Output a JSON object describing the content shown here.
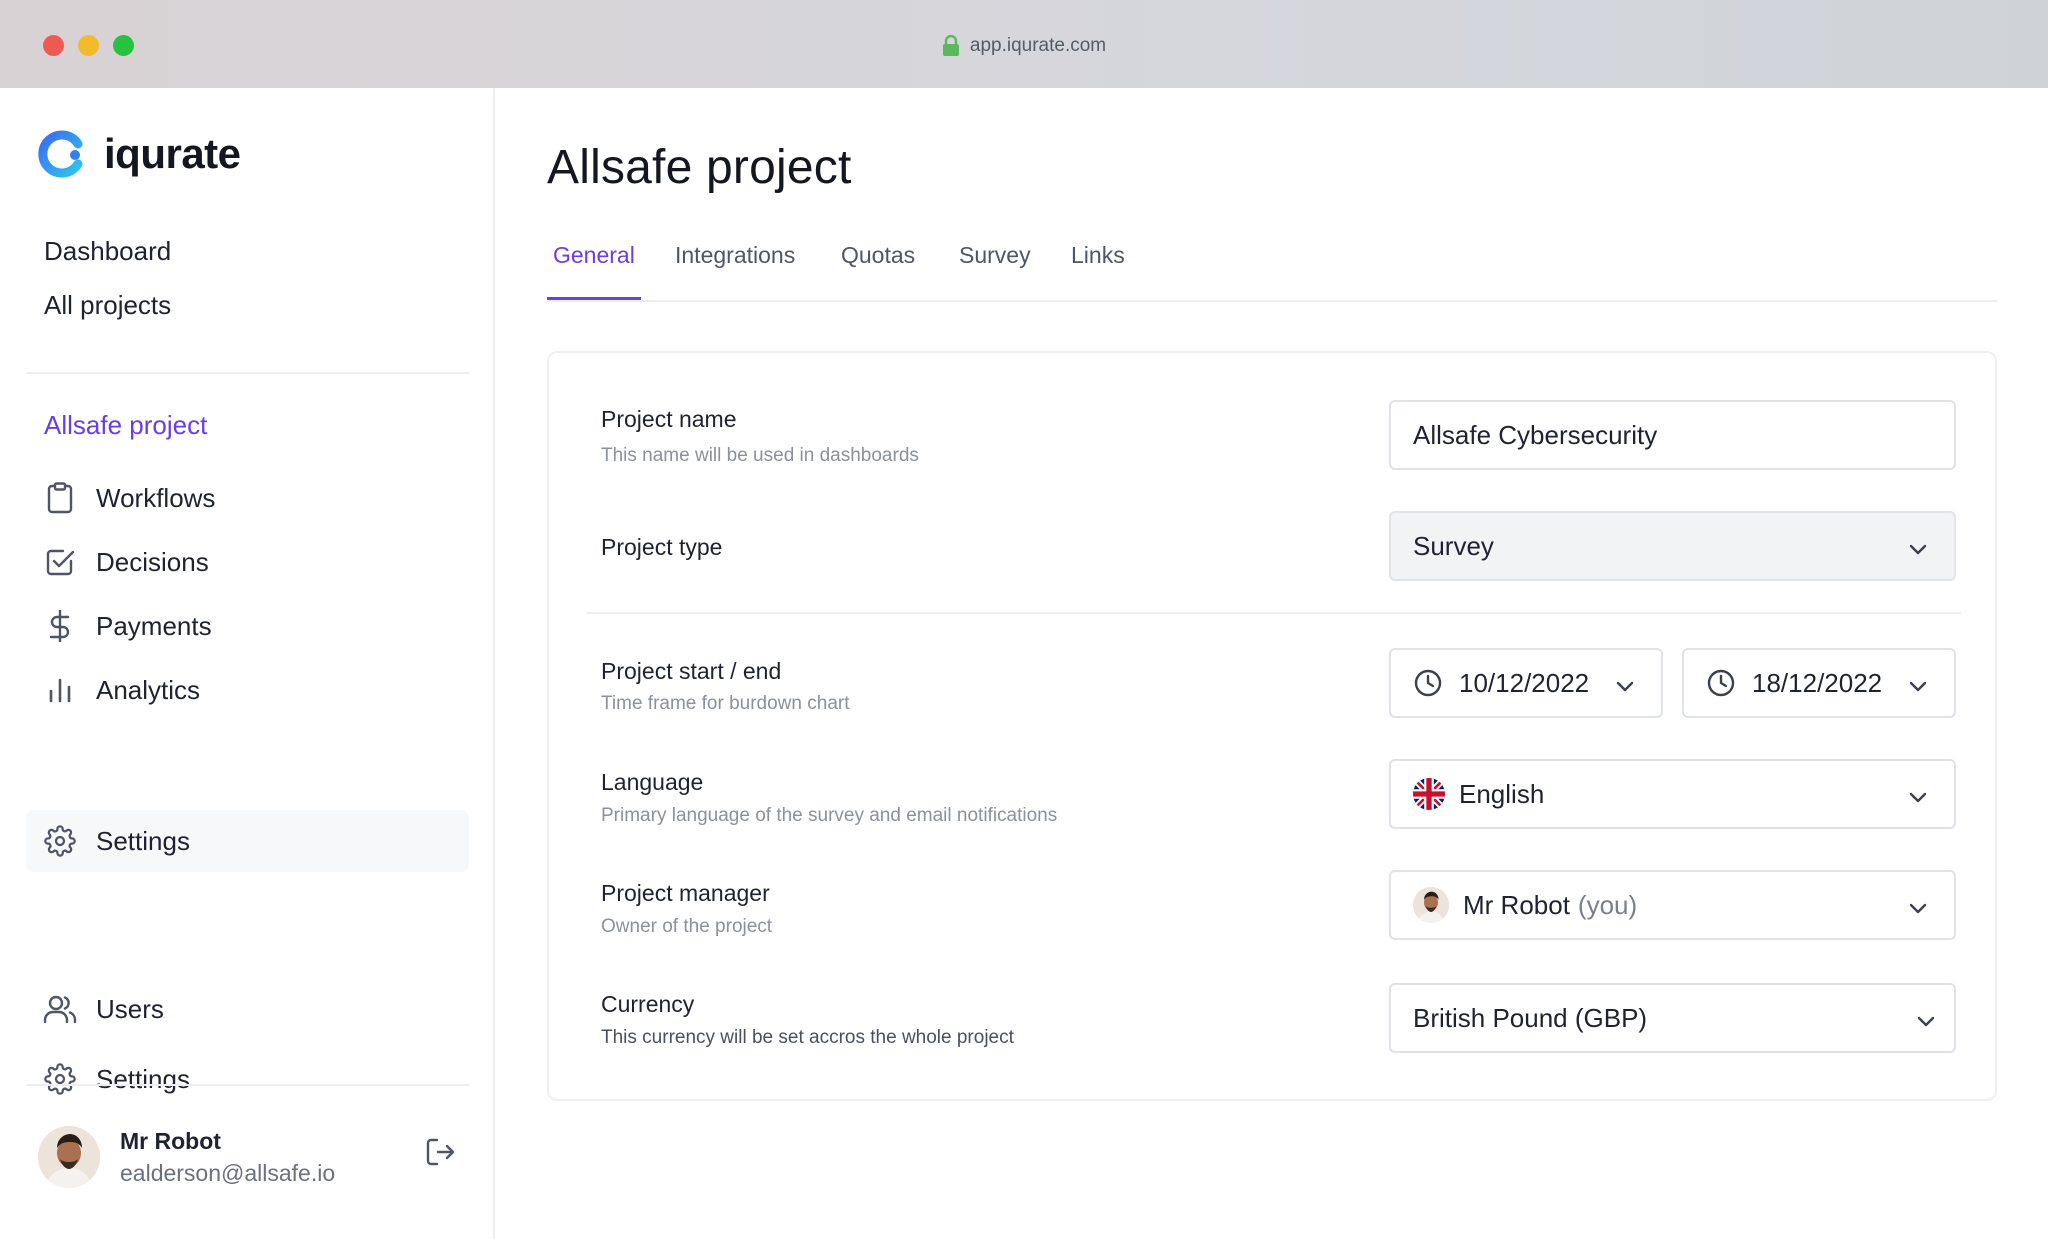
{
  "browser": {
    "url": "app.iqurate.com"
  },
  "brand": {
    "name": "iqurate"
  },
  "nav": {
    "dashboard": "Dashboard",
    "all_projects": "All projects",
    "project_title": "Allsafe project",
    "project_items": [
      {
        "label": "Workflows",
        "icon": "clipboard-icon"
      },
      {
        "label": "Decisions",
        "icon": "checkbox-icon"
      },
      {
        "label": "Payments",
        "icon": "dollar-icon"
      },
      {
        "label": "Analytics",
        "icon": "bar-chart-icon"
      },
      {
        "label": "Settings",
        "icon": "gear-icon"
      }
    ],
    "bottom_items": [
      {
        "label": "Users",
        "icon": "users-icon"
      },
      {
        "label": "Settings",
        "icon": "gear-icon"
      }
    ]
  },
  "user": {
    "name": "Mr Robot",
    "email": "ealderson@allsafe.io"
  },
  "page": {
    "title": "Allsafe project"
  },
  "tabs": [
    "General",
    "Integrations",
    "Quotas",
    "Survey",
    "Links"
  ],
  "form": {
    "project_name": {
      "label": "Project name",
      "help": "This name will be used in dashboards",
      "value": "Allsafe Cybersecurity"
    },
    "project_type": {
      "label": "Project type",
      "value": "Survey"
    },
    "project_dates": {
      "label": "Project start / end",
      "help": "Time frame for burdown chart",
      "start": "10/12/2022",
      "end": "18/12/2022"
    },
    "language": {
      "label": "Language",
      "help": "Primary language of the survey and email notifications",
      "value": "English"
    },
    "manager": {
      "label": "Project manager",
      "help": "Owner of the project",
      "value": "Mr Robot",
      "suffix": "(you)"
    },
    "currency": {
      "label": "Currency",
      "help": "This currency will be set accros the whole project",
      "value": "British Pound (GBP)"
    }
  },
  "colors": {
    "accent": "#6a3de8",
    "border": "#dfe2e7",
    "muted": "#8b909c"
  }
}
